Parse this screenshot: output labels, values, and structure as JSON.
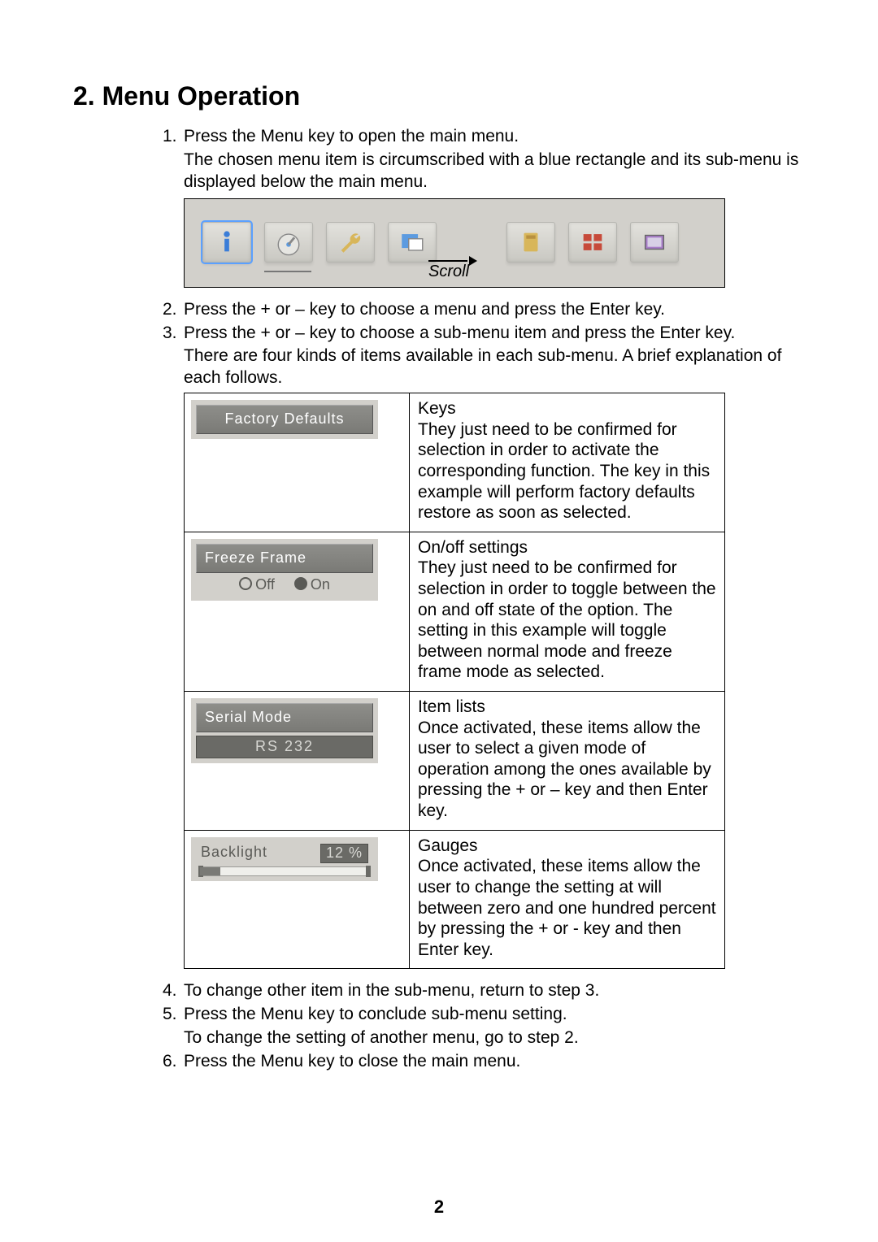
{
  "heading": "2. Menu Operation",
  "steps": {
    "s1": {
      "num": "1.",
      "text": "Press the Menu key to open the main menu."
    },
    "s1b": "The chosen menu item is circumscribed with a blue rectangle and its sub-menu is displayed below the main menu.",
    "s2": {
      "num": "2.",
      "text": "Press the + or – key to choose a menu and press the Enter key."
    },
    "s3": {
      "num": "3.",
      "text": "Press the + or – key to choose a sub-menu item and press the Enter key."
    },
    "s3b": "There are four kinds of items available in each sub-menu. A brief explanation of each follows.",
    "s4": {
      "num": "4.",
      "text": "To change other item in the sub-menu, return to step 3."
    },
    "s5": {
      "num": "5.",
      "text": "Press the Menu key to conclude sub-menu setting."
    },
    "s5b": "To change the setting of another menu, go to step 2.",
    "s6": {
      "num": "6.",
      "text": "Press the Menu key to close the main menu."
    }
  },
  "menu_icons": [
    {
      "name": "info-icon",
      "selected": true
    },
    {
      "name": "gauge-icon",
      "selected": false
    },
    {
      "name": "wrench-icon",
      "selected": false
    },
    {
      "name": "window-icon",
      "selected": false
    },
    {
      "name": "card-icon",
      "selected": false
    },
    {
      "name": "grid-icon",
      "selected": false
    },
    {
      "name": "monitor-icon",
      "selected": false
    }
  ],
  "scroll_label": "Scroll",
  "items_table": {
    "row1": {
      "btn": "Factory Defaults",
      "title": "Keys",
      "body": "They just need to be confirmed for selection in order to activate the corresponding function. The key in this example will perform factory defaults restore as soon as selected."
    },
    "row2": {
      "btn": "Freeze Frame",
      "off": "Off",
      "on": "On",
      "title": "On/off settings",
      "body": "They just need to be confirmed for selection in order to toggle between the on and off state of the option. The setting in this example will toggle between normal mode and freeze frame mode as selected."
    },
    "row3": {
      "btn": "Serial Mode",
      "value": "RS 232",
      "title": "Item lists",
      "body": "Once activated, these items allow the user to select a given mode of operation among the ones available by pressing the + or – key and then Enter key."
    },
    "row4": {
      "btn": "Backlight",
      "value": "12 %",
      "percent": 12,
      "title": "Gauges",
      "body": "Once activated, these items allow the user to change the setting at will between zero and one hundred percent by pressing the + or - key and then Enter key."
    }
  },
  "page_number": "2"
}
